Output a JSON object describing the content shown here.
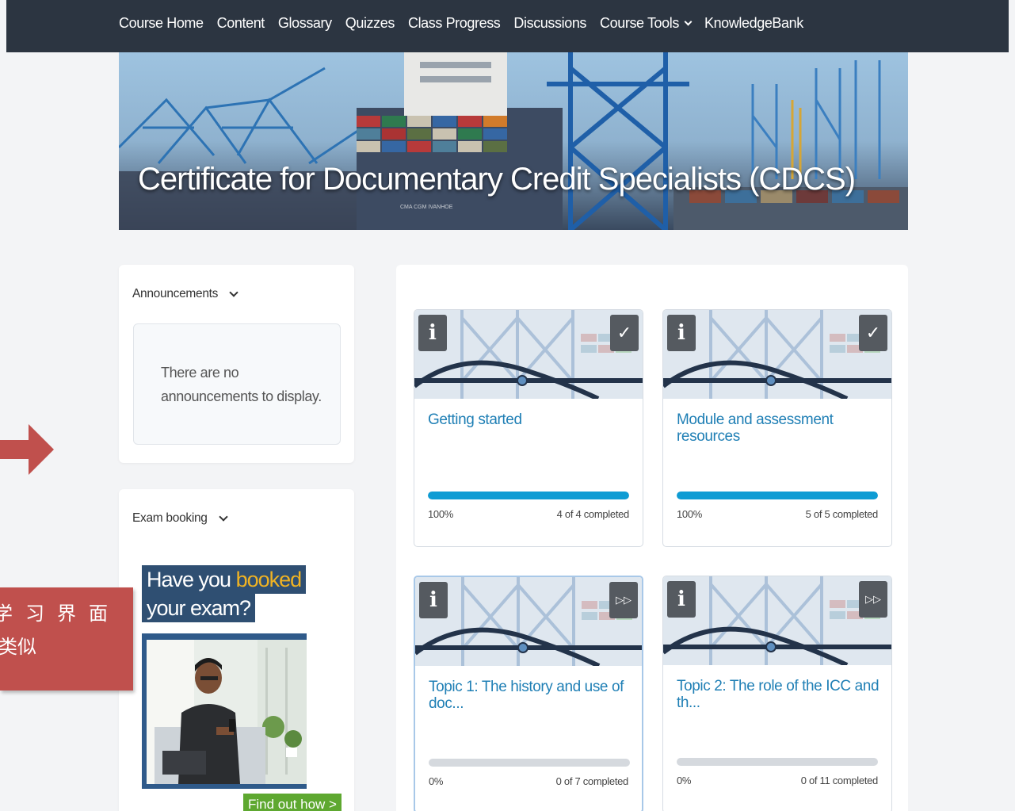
{
  "nav": {
    "items": [
      {
        "label": "Course Home",
        "dropdown": false
      },
      {
        "label": "Content",
        "dropdown": false
      },
      {
        "label": "Glossary",
        "dropdown": false
      },
      {
        "label": "Quizzes",
        "dropdown": false
      },
      {
        "label": "Class Progress",
        "dropdown": false
      },
      {
        "label": "Discussions",
        "dropdown": false
      },
      {
        "label": "Course Tools",
        "dropdown": true
      },
      {
        "label": "KnowledgeBank",
        "dropdown": false
      }
    ]
  },
  "banner": {
    "title": "Certificate for Documentary Credit Specialists (CDCS)",
    "ship_text": "CMA CGM IVANHOE"
  },
  "announcements": {
    "heading": "Announcements",
    "empty_line1": "There are no",
    "empty_line2": "announcements to display."
  },
  "exam_booking": {
    "heading": "Exam booking",
    "ad_line1_a": "Have you ",
    "ad_line1_b": "booked",
    "ad_line2": "your exam?",
    "cta": "Find out how >"
  },
  "modules": [
    {
      "title": "Getting started",
      "percent_label": "100%",
      "progress": 1.0,
      "count": "4 of 4 completed",
      "status_icon": "check-icon"
    },
    {
      "title": "Module and assessment resources",
      "percent_label": "100%",
      "progress": 1.0,
      "count": "5 of 5 completed",
      "status_icon": "check-icon"
    },
    {
      "title": "Topic 1: The history and use of doc...",
      "percent_label": "0%",
      "progress": 0.0,
      "count": "0 of 7 completed",
      "status_icon": "fast-forward-icon"
    },
    {
      "title": "Topic 2: The role of the ICC and th...",
      "percent_label": "0%",
      "progress": 0.0,
      "count": "0 of 11 completed",
      "status_icon": "fast-forward-icon"
    }
  ],
  "annotation": {
    "line1": "学习界面",
    "line2": "类似"
  },
  "colors": {
    "nav_bg": "#2c3541",
    "accent": "#1f7fb5",
    "progress": "#0e9cd4",
    "note_red": "#c0504d"
  }
}
